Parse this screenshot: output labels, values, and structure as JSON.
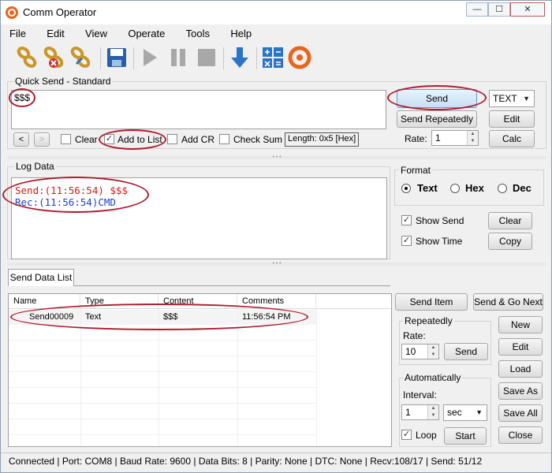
{
  "window": {
    "title": "Comm Operator",
    "controls": {
      "minimize": "—",
      "maximize": "☐",
      "close": "✕"
    }
  },
  "menu": [
    "File",
    "Edit",
    "View",
    "Operate",
    "Tools",
    "Help"
  ],
  "toolbar": {
    "icons": [
      "connect-icon",
      "disconnect-icon",
      "settings-icon",
      "save-icon",
      "play-icon",
      "pause-icon",
      "stop-icon",
      "download-icon",
      "calculator-icon",
      "app-logo-icon"
    ],
    "colors": {
      "gold": "#c8962a",
      "red": "#d03030",
      "blue": "#2a74c8",
      "gray": "#a8a8a8",
      "orange": "#e8651c"
    }
  },
  "quick_send": {
    "group_label": "Quick Send - Standard",
    "input_value": "$$$",
    "send_label": "Send",
    "format_value": "TEXT",
    "send_repeatedly_label": "Send Repeatedly",
    "edit_label": "Edit",
    "rate_label": "Rate:",
    "rate_value": "1",
    "calc_label": "Calc",
    "prev_label": "<",
    "next_label": ">",
    "clear_label": "Clear",
    "add_to_list_label": "Add to List",
    "add_cr_label": "Add CR",
    "check_sum_label": "Check Sum",
    "length_label": "Length: 0x5 [Hex]"
  },
  "log": {
    "group_label": "Log Data",
    "lines": [
      {
        "text": "Send:(11:56:54) $$$",
        "color": "#d81818"
      },
      {
        "text": "Rec:(11:56:54)CMD",
        "color": "#1b3fd0"
      }
    ],
    "format_label": "Format",
    "format_options": [
      "Text",
      "Hex",
      "Dec"
    ],
    "format_selected": "Text",
    "show_send_label": "Show Send",
    "show_time_label": "Show Time",
    "clear_label": "Clear",
    "copy_label": "Copy"
  },
  "send_list": {
    "tab_label": "Send Data List",
    "columns": [
      "Name",
      "Type",
      "Content",
      "Comments"
    ],
    "rows": [
      {
        "name": "Send00009",
        "type": "Text",
        "content": "$$$",
        "comments": "11:56:54 PM"
      }
    ],
    "send_item_label": "Send Item",
    "send_go_next_label": "Send & Go Next",
    "repeatedly_label": "Repeatedly",
    "rate_label": "Rate:",
    "rate_value": "10",
    "send_label": "Send",
    "automatically_label": "Automatically",
    "interval_label": "Interval:",
    "interval_value": "1",
    "unit_value": "sec",
    "loop_label": "Loop",
    "start_label": "Start",
    "new_label": "New",
    "edit_label": "Edit",
    "load_label": "Load",
    "save_as_label": "Save As",
    "save_all_label": "Save All",
    "close_label": "Close"
  },
  "status": "Connected | Port: COM8 | Baud Rate: 9600 | Data Bits: 8 | Parity: None | DTC: None | Recv:108/17 | Send: 51/12"
}
